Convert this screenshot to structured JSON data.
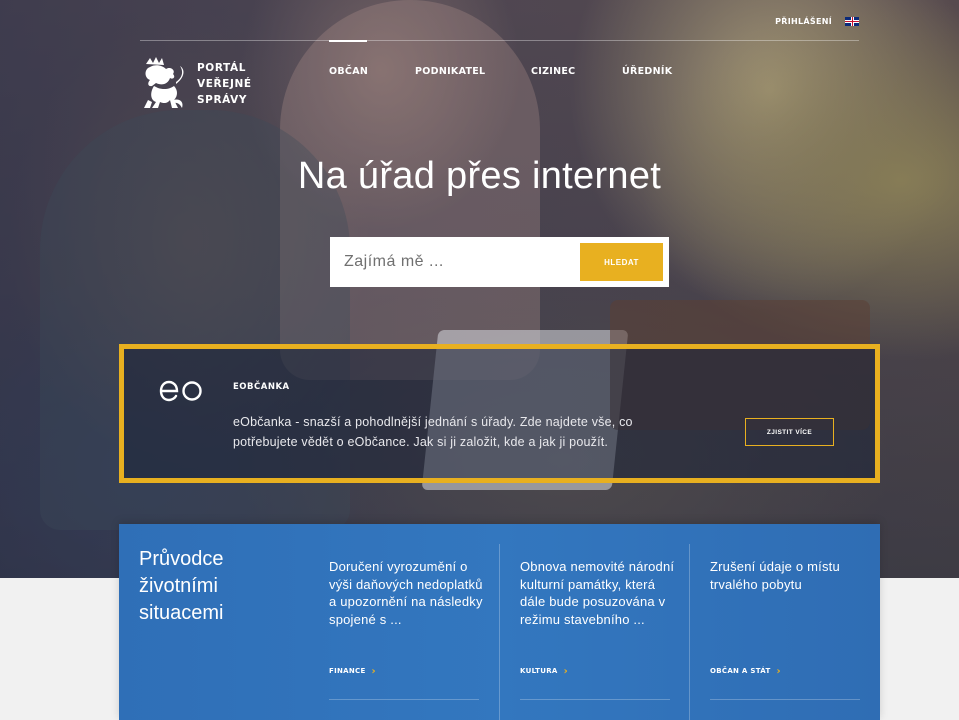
{
  "header": {
    "login_label": "PŘIHLÁŠENÍ",
    "language_icon": "uk-flag-icon",
    "logo_lines": [
      "PORTÁL",
      "VEŘEJNÉ",
      "SPRÁVY"
    ],
    "nav": [
      {
        "label": "OBČAN",
        "active": true
      },
      {
        "label": "PODNIKATEL",
        "active": false
      },
      {
        "label": "CIZINEC",
        "active": false
      },
      {
        "label": "ÚŘEDNÍK",
        "active": false
      }
    ]
  },
  "hero": {
    "title": "Na úřad přes internet",
    "search_placeholder": "Zajímá mě ...",
    "search_button": "HLEDAT"
  },
  "eobcanka": {
    "logo_text": "eo",
    "title": "EOBČANKA",
    "description": "eObčanka - snazší a pohodlnější jednání s úřady. Zde najdete vše, co potřebujete vědět o eObčance. Jak si ji založit, kde a jak ji použít.",
    "button": "ZJISTIT VÍCE"
  },
  "situations": {
    "title": "Průvodce životními situacemi",
    "cards": [
      {
        "text": "Doručení vyrozumění o výši daňových nedoplatků a upozornění na následky spojené s ...",
        "category": "FINANCE"
      },
      {
        "text": "Obnova nemovité národní kulturní památky, která dále bude posuzována v režimu stavebního ...",
        "category": "KULTURA"
      },
      {
        "text": "Zrušení údaje o místu trvalého pobytu",
        "category": "OBČAN A STÁT"
      }
    ]
  },
  "colors": {
    "accent": "#e8b020",
    "panel_blue": "#3377bf"
  }
}
